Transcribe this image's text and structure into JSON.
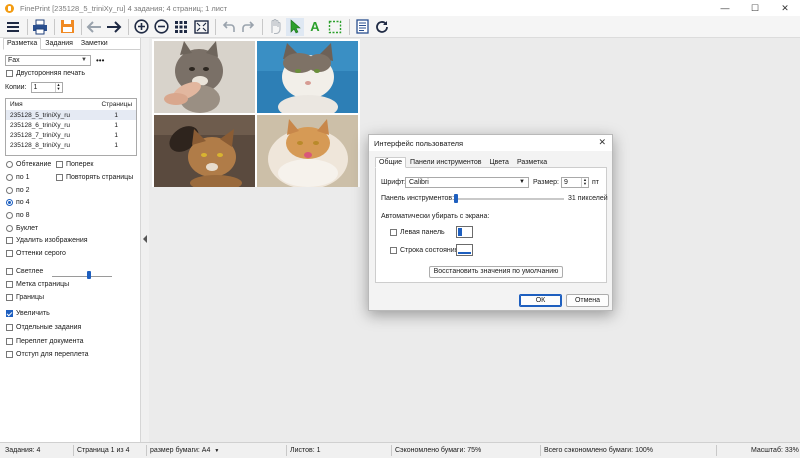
{
  "window": {
    "title": "FinePrint [235128_5_triniXy_ru] 4 задания; 4 страниц; 1 лист",
    "minimize": "—",
    "maximize": "☐",
    "close": "✕"
  },
  "toolbar": {
    "icons": [
      "menu-icon",
      "print-icon",
      "save-icon",
      "back-icon",
      "forward-icon",
      "zoom-in-icon",
      "zoom-out-icon",
      "grid-icon",
      "fit-icon",
      "undo-icon",
      "redo-icon",
      "hand-icon",
      "pointer-icon",
      "text-icon",
      "select-icon",
      "page-settings-icon",
      "refresh-icon"
    ],
    "text_tool_label": "A"
  },
  "left_panel": {
    "tabs": [
      "Разметка",
      "Задания",
      "Заметки"
    ],
    "active_tab": "Разметка",
    "printer": "Fax",
    "more": "•••",
    "duplex_label": "Двусторонняя печать",
    "copies_label": "Копии:",
    "copies_value": "1",
    "jobs_header": {
      "name": "Имя",
      "pages": "Страницы"
    },
    "jobs": [
      {
        "name": "235128_5_triniXy_ru",
        "pages": "1"
      },
      {
        "name": "235128_6_triniXy_ru",
        "pages": "1"
      },
      {
        "name": "235128_7_triniXy_ru",
        "pages": "1"
      },
      {
        "name": "235128_8_triniXy_ru",
        "pages": "1"
      }
    ],
    "layout_options": {
      "wrap": "Обтекание",
      "across": "Поперек",
      "per1": "по 1",
      "repeat": "Повторять страницы",
      "per2": "по 2",
      "per4": "по 4",
      "per8": "по 8",
      "booklet": "Буклет"
    },
    "selected_layout": "по 4",
    "checks": {
      "remove_images": "Удалить изображения",
      "grayscale": "Оттенки серого",
      "lighter": "Светлее",
      "page_mark": "Метка страницы",
      "borders": "Границы",
      "enlarge": "Увеличить",
      "separate_jobs": "Отдельные задания",
      "doc_binding": "Переплет документа",
      "binding_margin": "Отступ для переплета"
    },
    "enlarge_checked": true,
    "enlarge_slider_level": 0.62
  },
  "dialog": {
    "title": "Интерфейс пользователя",
    "close": "✕",
    "tabs": [
      "Общие",
      "Панели инструментов",
      "Цвета",
      "Разметка"
    ],
    "active_tab": "Общие",
    "font_label": "Шрифт:",
    "font_value": "Calibri",
    "size_label": "Размер:",
    "size_value": "9",
    "size_unit": "пт",
    "toolbar_label": "Панель инструментов:",
    "toolbar_value": "31 пикселей",
    "toolbar_slider_level": 0.0,
    "auto_hide_label": "Автоматически убирать с экрана:",
    "left_panel_label": "Левая панель",
    "status_bar_label": "Строка состояния",
    "restore_label": "Восстановить значения по умолчанию",
    "ok_label": "ОК",
    "cancel_label": "Отмена"
  },
  "status": {
    "jobs": "Задания: 4",
    "page": "Страница 1 из 4",
    "paper": "размер бумаги: A4",
    "sheets": "Листов: 1",
    "saved": "Сэкономлено бумаги: 75%",
    "total_saved": "Всего сэкономлено бумаги: 100%",
    "zoom": "Масштаб: 33%"
  },
  "colors": {
    "accent": "#1e5fbf",
    "toolbar_bg": "#f5f5f5",
    "canvas_bg": "#ebebeb",
    "app_icon": "#f39c12",
    "pointer_icon": "#2ca02c"
  }
}
